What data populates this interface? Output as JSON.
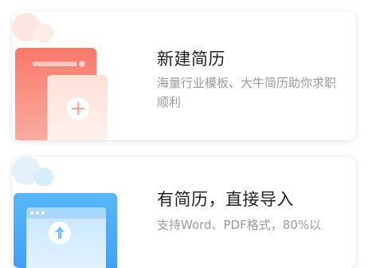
{
  "cards": [
    {
      "title": "新建简历",
      "desc": "海量行业模板、大牛简历助你求职顺利",
      "accent": "#f87a6c",
      "icon": "plus-icon"
    },
    {
      "title": "有简历，直接导入",
      "desc": "支持Word、PDF格式，80%以",
      "accent": "#3f9cf5",
      "icon": "upload-cloud-icon"
    }
  ]
}
